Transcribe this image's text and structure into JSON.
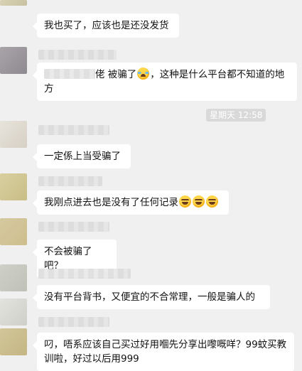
{
  "messages": [
    {
      "text": "我也买了，应该也是还没发货"
    },
    {
      "sender_partial": "佬",
      "text_before_emoji": " 被骗了",
      "text_after_emoji": "，这种是什么平台都不知道的地方",
      "emoji": "sob-icon"
    },
    {
      "text": "一定係上当受骗了"
    },
    {
      "text": "我刚点进去也是没有了任何记录",
      "emojis": [
        "laugh-icon",
        "laugh-icon",
        "laugh-icon"
      ]
    },
    {
      "text": "不会被骗了吧？"
    },
    {
      "text": "没有平台背书，又便宜的不合常理，一般是骗人的"
    },
    {
      "text": "叼，唔系应该自己买过好用嗰先分享出嚟嘅咩？99蚊买教训啦，好过以后用999"
    }
  ],
  "timestamp": "星期天 12:58"
}
